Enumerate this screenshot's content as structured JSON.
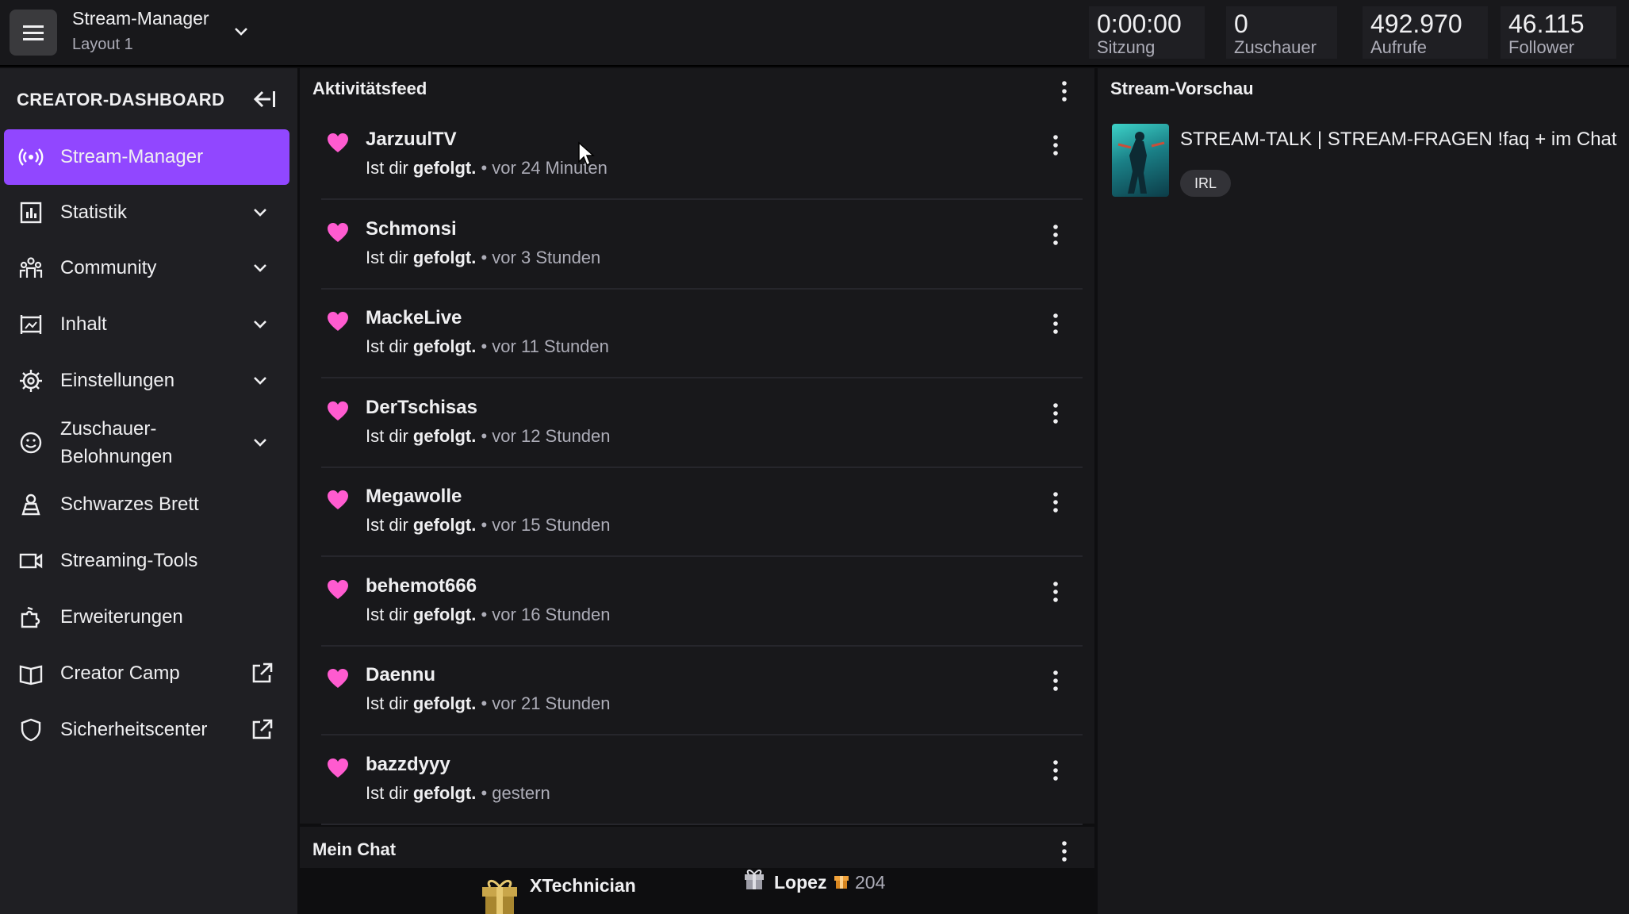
{
  "header": {
    "app_title": "Stream-Manager",
    "layout": "Layout 1",
    "stats": [
      {
        "value": "0:00:00",
        "label": "Sitzung"
      },
      {
        "value": "0",
        "label": "Zuschauer"
      },
      {
        "value": "492.970",
        "label": "Aufrufe"
      },
      {
        "value": "46.115",
        "label": "Follower"
      }
    ]
  },
  "sidebar": {
    "heading": "CREATOR-DASHBOARD",
    "items": [
      {
        "label": "Stream-Manager",
        "icon": "broadcast-icon"
      },
      {
        "label": "Statistik",
        "icon": "chart-icon"
      },
      {
        "label": "Community",
        "icon": "community-icon"
      },
      {
        "label": "Inhalt",
        "icon": "content-icon"
      },
      {
        "label": "Einstellungen",
        "icon": "gear-icon"
      },
      {
        "label": "Zuschauer-",
        "label2": "Belohnungen",
        "icon": "rewards-icon"
      },
      {
        "label": "Schwarzes Brett",
        "icon": "bulletin-icon"
      },
      {
        "label": "Streaming-Tools",
        "icon": "camera-icon"
      },
      {
        "label": "Erweiterungen",
        "icon": "puzzle-icon"
      },
      {
        "label": "Creator Camp",
        "icon": "book-icon"
      },
      {
        "label": "Sicherheitscenter",
        "icon": "shield-icon"
      }
    ]
  },
  "feed": {
    "title": "Aktivitätsfeed",
    "action_prefix": "Ist dir",
    "action_bold": "gefolgt.",
    "items": [
      {
        "name": "JarzuulTV",
        "time": "vor 24 Minuten"
      },
      {
        "name": "Schmonsi",
        "time": "vor 3 Stunden"
      },
      {
        "name": "MackeLive",
        "time": "vor 11 Stunden"
      },
      {
        "name": "DerTschisas",
        "time": "vor 12 Stunden"
      },
      {
        "name": "Megawolle",
        "time": "vor 15 Stunden"
      },
      {
        "name": "behemot666",
        "time": "vor 16 Stunden"
      },
      {
        "name": "Daennu",
        "time": "vor 21 Stunden"
      },
      {
        "name": "bazzdyyy",
        "time": "gestern"
      }
    ]
  },
  "chat": {
    "title": "Mein Chat",
    "users": [
      {
        "name": "XTechnician"
      },
      {
        "name": "Lopez",
        "count": "204"
      }
    ]
  },
  "preview": {
    "title": "Stream-Vorschau",
    "stream_title": "STREAM-TALK | STREAM-FRAGEN !faq + im Chat",
    "tag": "IRL"
  },
  "colors": {
    "accent": "#9147ff",
    "heart": "#ff5bd0"
  }
}
